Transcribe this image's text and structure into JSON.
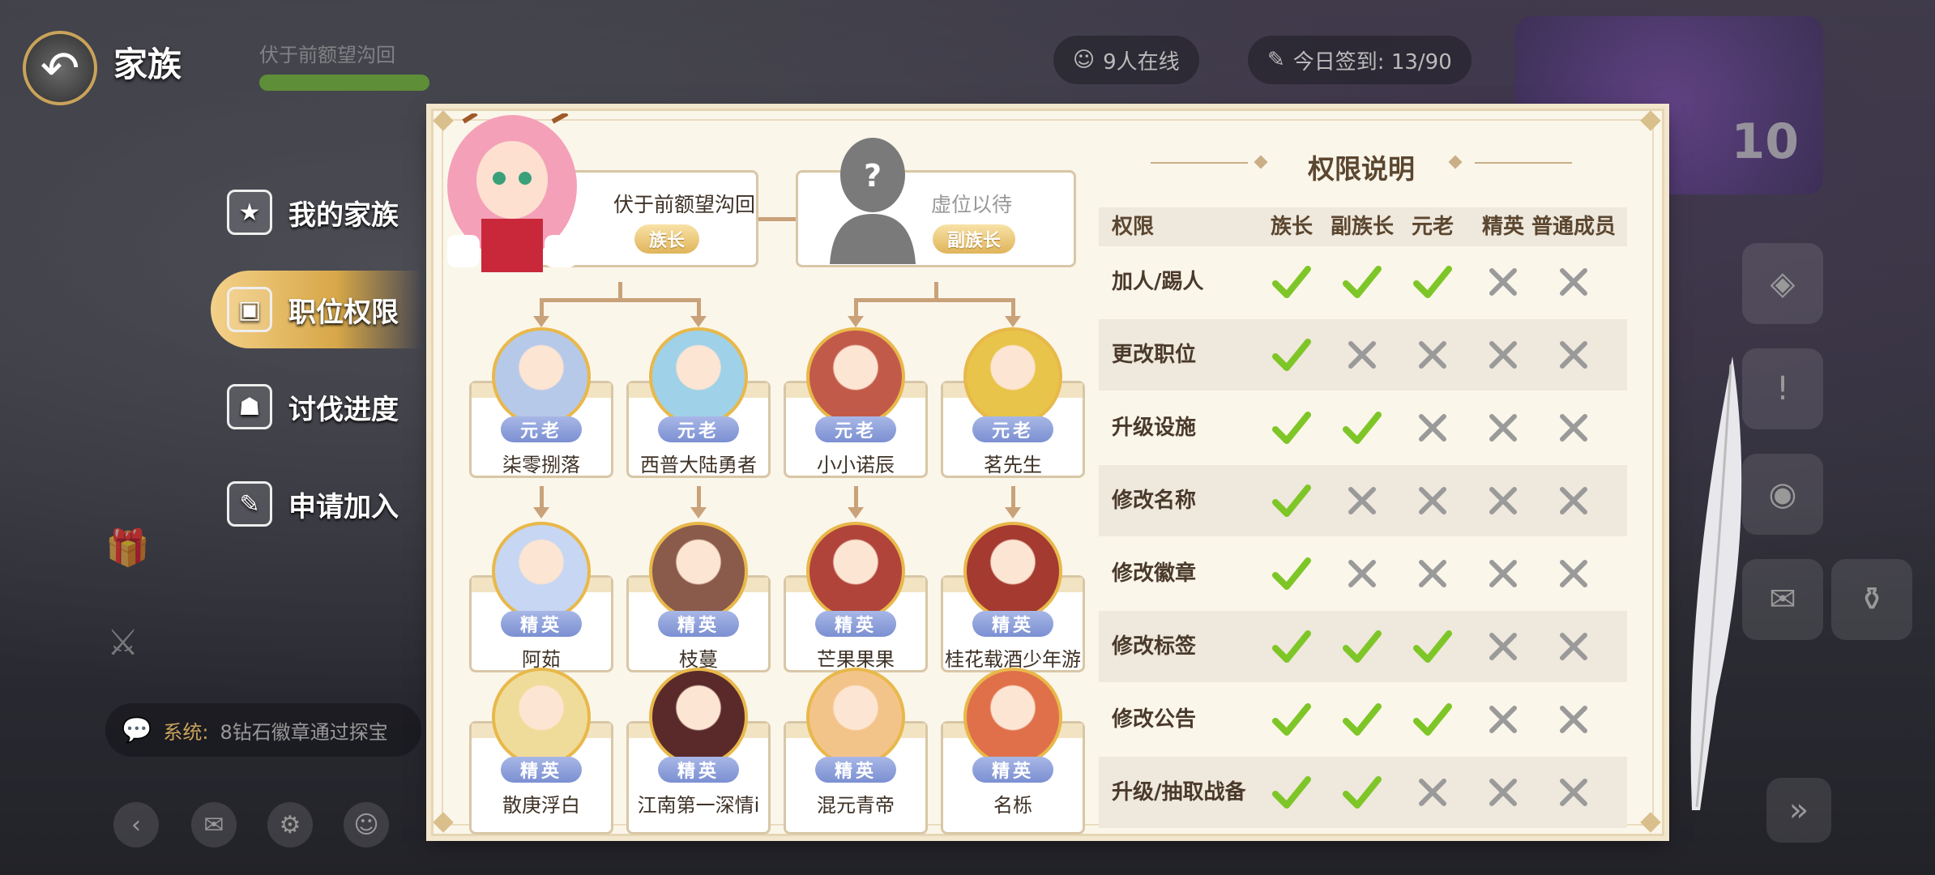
{
  "header": {
    "title": "家族",
    "family_name": "伏于前额望沟回",
    "online": "9人在线",
    "checkin": "今日签到: 13/90",
    "event_level": "10"
  },
  "menu": [
    {
      "label": "我的家族",
      "icon": "family-book-icon"
    },
    {
      "label": "职位权限",
      "icon": "badge-icon",
      "active": true
    },
    {
      "label": "讨伐进度",
      "icon": "monster-icon"
    },
    {
      "label": "申请加入",
      "icon": "apply-edit-icon"
    }
  ],
  "chat": {
    "prefix": "系统:",
    "text": "8钻石徽章通过探宝"
  },
  "leaders": {
    "chief": {
      "name": "伏于前额望沟回",
      "role": "族长"
    },
    "vice": {
      "name": "虚位以待",
      "role": "副族长"
    }
  },
  "members": [
    {
      "name": "柒零捌落",
      "role": "元老",
      "color": "#b7c9e8"
    },
    {
      "name": "西普大陆勇者",
      "role": "元老",
      "color": "#9fd1e8"
    },
    {
      "name": "小小诺辰",
      "role": "元老",
      "color": "#c25a4a"
    },
    {
      "name": "茗先生",
      "role": "元老",
      "color": "#e8c44a"
    },
    {
      "name": "阿茹",
      "role": "精英",
      "color": "#c7d6f2"
    },
    {
      "name": "枝蔓",
      "role": "精英",
      "color": "#8a5a4a"
    },
    {
      "name": "芒果果果",
      "role": "精英",
      "color": "#b0443a"
    },
    {
      "name": "桂花载酒少年游",
      "role": "精英",
      "color": "#a43a30"
    },
    {
      "name": "散庚浮白",
      "role": "精英",
      "color": "#f0dc9a"
    },
    {
      "name": "江南第一深情i",
      "role": "精英",
      "color": "#5a2a2a"
    },
    {
      "name": "混元青帝",
      "role": "精英",
      "color": "#f3c48a"
    },
    {
      "name": "名栎",
      "role": "精英",
      "color": "#e0704a"
    }
  ],
  "permissions": {
    "title": "权限说明",
    "columns": [
      "权限",
      "族长",
      "副族长",
      "元老",
      "精英",
      "普通成员"
    ],
    "rows": [
      {
        "label": "加人/踢人",
        "values": [
          true,
          true,
          true,
          false,
          false
        ]
      },
      {
        "label": "更改职位",
        "values": [
          true,
          false,
          false,
          false,
          false
        ]
      },
      {
        "label": "升级设施",
        "values": [
          true,
          true,
          false,
          false,
          false
        ]
      },
      {
        "label": "修改名称",
        "values": [
          true,
          false,
          false,
          false,
          false
        ]
      },
      {
        "label": "修改徽章",
        "values": [
          true,
          false,
          false,
          false,
          false
        ]
      },
      {
        "label": "修改标签",
        "values": [
          true,
          true,
          true,
          false,
          false
        ]
      },
      {
        "label": "修改公告",
        "values": [
          true,
          true,
          true,
          false,
          false
        ]
      },
      {
        "label": "升级/抽取战备",
        "values": [
          true,
          true,
          false,
          false,
          false
        ]
      }
    ]
  },
  "colors": {
    "check": "#7ec628",
    "cross": "#9a9a9a",
    "gold": "#d7a748",
    "elite_badge": "#8a9bd8"
  }
}
